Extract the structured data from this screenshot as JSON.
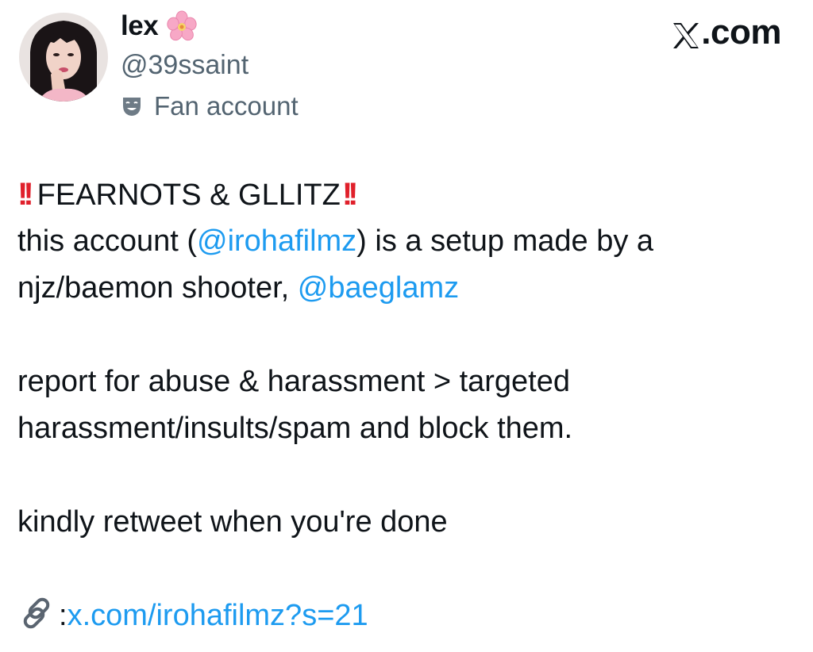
{
  "author": {
    "display_name": "lex",
    "name_emoji": "cherry-blossom-icon",
    "handle": "@39ssaint",
    "account_label": "Fan account",
    "label_icon": "theater-masks-icon"
  },
  "brand": {
    "text": ".com",
    "logo": "x-logo-icon"
  },
  "tweet": {
    "header_title": "FEARNOTS & GLLITZ",
    "header_emoji": "double-exclamation-icon",
    "line1_pre": "this account (",
    "line1_mention": "@irohafilmz",
    "line1_post": ") is a setup made by a",
    "line2_pre": "njz/baemon shooter, ",
    "line2_mention": "@baeglamz",
    "para2_line1": "report for abuse & harassment > targeted",
    "para2_line2": "harassment/insults/spam and block them.",
    "para3": "kindly retweet when you're done",
    "link_icon": "link-chain-icon",
    "link_sep": ":",
    "link_text": "x.com/irohafilmz?s=21"
  },
  "colors": {
    "text": "#0f1419",
    "secondary": "#536471",
    "link": "#1d9bf0",
    "exclamation": "#e0202b"
  }
}
